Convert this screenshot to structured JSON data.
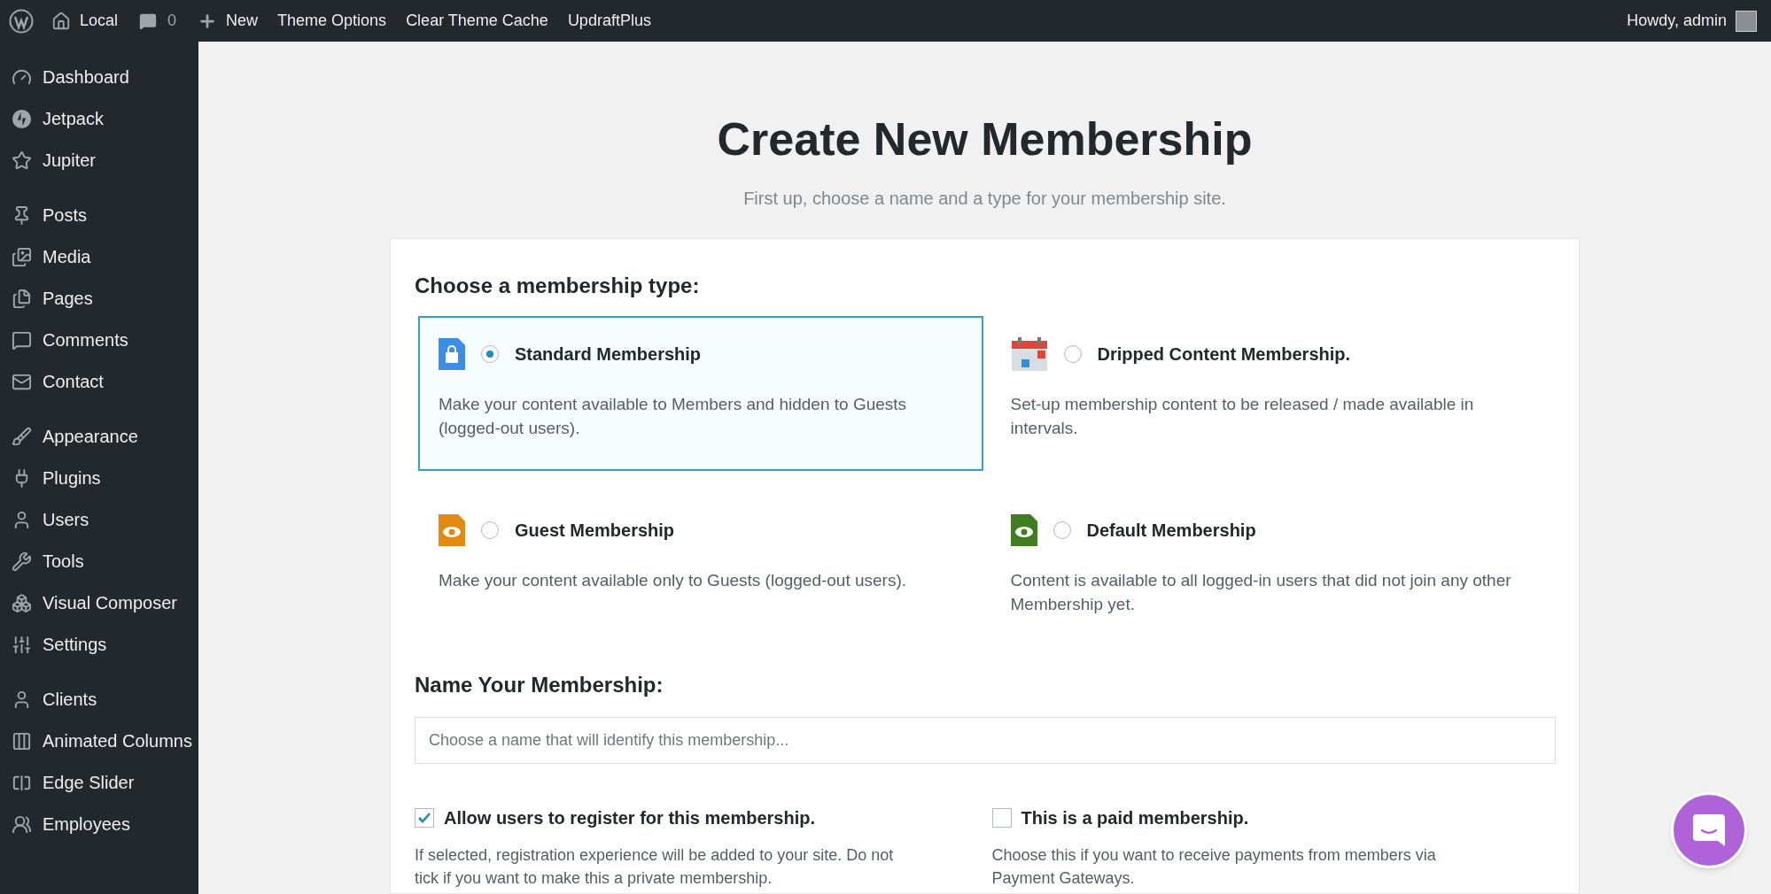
{
  "admin_bar": {
    "site": "Local",
    "comments": "0",
    "new": "New",
    "links": [
      "Theme Options",
      "Clear Theme Cache",
      "UpdraftPlus"
    ],
    "greeting": "Howdy, admin"
  },
  "sidebar": {
    "groups": [
      {
        "items": [
          "Dashboard",
          "Jetpack",
          "Jupiter"
        ]
      },
      {
        "items": [
          "Posts",
          "Media",
          "Pages",
          "Comments",
          "Contact"
        ]
      },
      {
        "items": [
          "Appearance",
          "Plugins",
          "Users",
          "Tools",
          "Visual Composer",
          "Settings"
        ]
      },
      {
        "items": [
          "Clients",
          "Animated Columns",
          "Edge Slider",
          "Employees"
        ]
      }
    ]
  },
  "page": {
    "title": "Create New Membership",
    "subtitle": "First up, choose a name and a type for your membership site."
  },
  "type_section": {
    "heading": "Choose a membership type:",
    "options": [
      {
        "title": "Standard Membership",
        "description": "Make your content available to Members and hidden to Guests (logged-out users).",
        "selected": true
      },
      {
        "title": "Dripped Content Membership.",
        "description": "Set-up membership content to be released / made available in intervals.",
        "selected": false
      },
      {
        "title": "Guest Membership",
        "description": "Make your content available only to Guests (logged-out users).",
        "selected": false
      },
      {
        "title": "Default Membership",
        "description": "Content is available to all logged-in users that did not join any other Membership yet.",
        "selected": false
      }
    ]
  },
  "name_section": {
    "heading": "Name Your Membership:",
    "placeholder": "Choose a name that will identify this membership..."
  },
  "options": [
    {
      "label": "Allow users to register for this membership.",
      "description": "If selected, registration experience will be added to your site. Do not tick if you want to make this a private membership.",
      "checked": true
    },
    {
      "label": "This is a paid membership.",
      "description": "Choose this if you want to receive payments from members via Payment Gateways.",
      "checked": false
    }
  ]
}
